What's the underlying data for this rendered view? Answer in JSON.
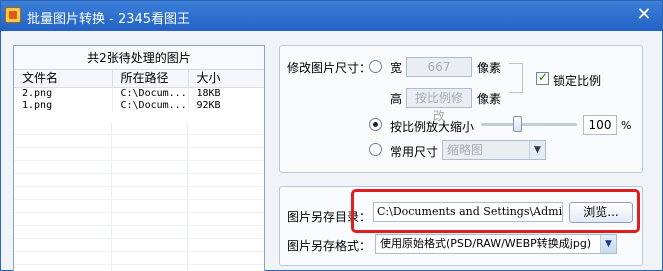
{
  "window": {
    "title": "批量图片转换 - 2345看图王",
    "close_glyph": "✕"
  },
  "file_list": {
    "header": "共2张待处理的图片",
    "columns": [
      "文件名",
      "所在路径",
      "大小"
    ],
    "rows": [
      [
        "2.png",
        "C:\\Docum...",
        "18KB"
      ],
      [
        "1.png",
        "C:\\Docum...",
        "92KB"
      ]
    ]
  },
  "resize": {
    "label": "修改图片尺寸：",
    "width_label": "宽",
    "width_value": "667",
    "pixel_unit": "像素",
    "height_label": "高",
    "height_value": "按比例修改",
    "lock_label": "锁定比例",
    "lock_checked": true,
    "scale_label": "按比例放大缩小",
    "scale_value": "100",
    "scale_unit": "%",
    "scale_level": 0.38,
    "preset_label": "常用尺寸",
    "preset_value": "缩略图"
  },
  "output": {
    "dir_label": "图片另存目录：",
    "dir_value": "C:\\Documents and Settings\\Admini",
    "browse_label": "浏览...",
    "format_label": "图片另存格式：",
    "format_value": "使用原始格式(PSD/RAW/WEBP转换成jpg)"
  },
  "colors": {
    "title_bar": "#2262c6",
    "highlight": "#e01e1e"
  }
}
